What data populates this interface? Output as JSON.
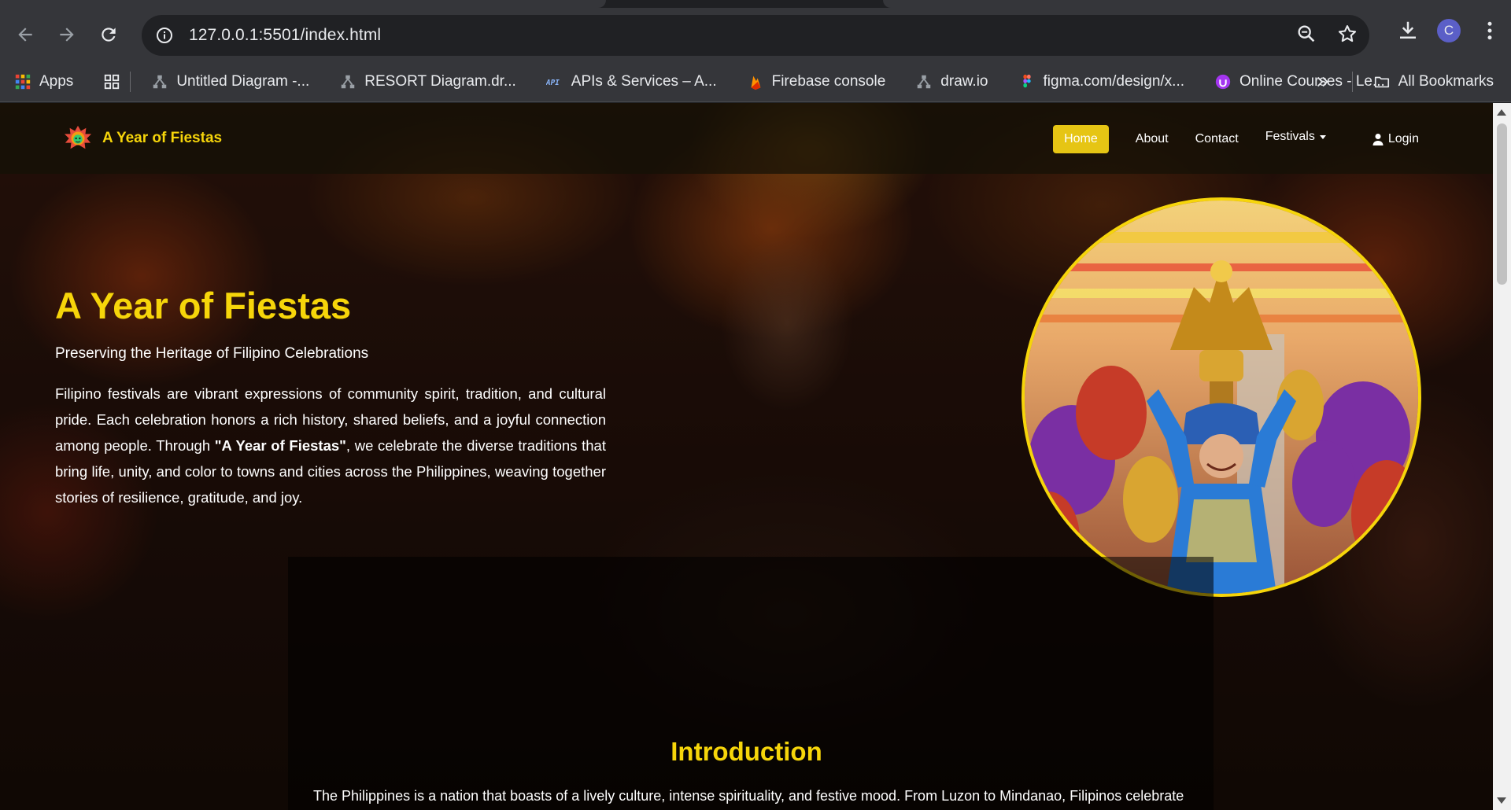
{
  "browser": {
    "url": "127.0.0.1:5501/index.html",
    "avatar_letter": "C",
    "bookmarks": [
      {
        "label": "Apps",
        "icon": "apps-grid-icon"
      },
      {
        "label": "Untitled Diagram -...",
        "icon": "drawio-icon"
      },
      {
        "label": "RESORT Diagram.dr...",
        "icon": "drawio-icon"
      },
      {
        "label": "APIs & Services – A...",
        "icon": "api-icon"
      },
      {
        "label": "Firebase console",
        "icon": "firebase-icon"
      },
      {
        "label": "draw.io",
        "icon": "drawio-icon"
      },
      {
        "label": "figma.com/design/x...",
        "icon": "figma-icon"
      },
      {
        "label": "Online Courses - Le...",
        "icon": "udemy-icon"
      }
    ],
    "all_bookmarks_label": "All Bookmarks"
  },
  "site": {
    "brand": "A Year of Fiestas",
    "nav": {
      "home": "Home",
      "about": "About",
      "contact": "Contact",
      "festivals": "Festivals",
      "login": "Login"
    },
    "hero": {
      "title": "A Year of Fiestas",
      "subtitle": "Preserving the Heritage of Filipino Celebrations",
      "body_before": "Filipino festivals are vibrant expressions of community spirit, tradition, and cultural pride. Each celebration honors a rich history, shared beliefs, and a joyful connection among people. Through ",
      "body_strong": "\"A Year of Fiestas\"",
      "body_after": ", we celebrate the diverse traditions that bring life, unity, and color to towns and cities across the Philippines, weaving together stories of resilience, gratitude, and joy."
    },
    "intro": {
      "title": "Introduction",
      "body": "The Philippines is a nation that boasts of a lively culture, intense spirituality, and festive mood. From Luzon to Mindanao, Filipinos celebrate"
    }
  },
  "colors": {
    "accent": "#f6d50a",
    "home_button": "#e6c514",
    "chrome": "#35363a"
  }
}
